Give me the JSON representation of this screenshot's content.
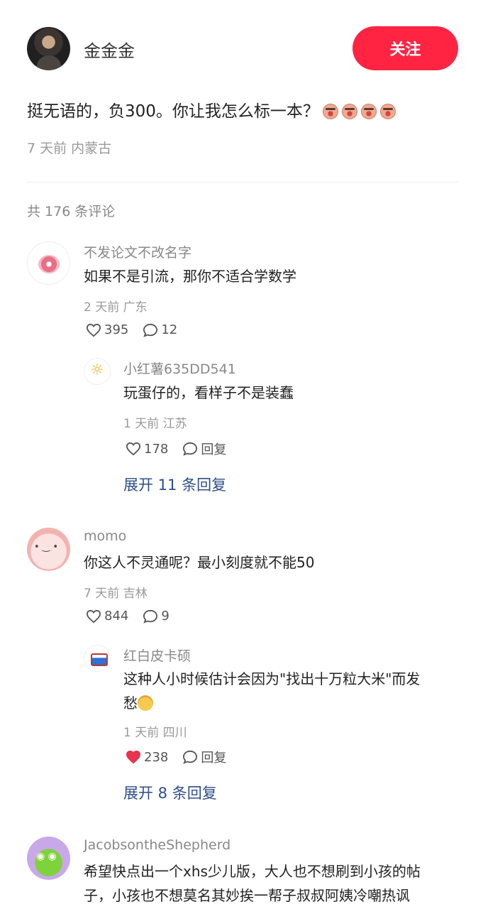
{
  "author": {
    "name": "金金金",
    "follow_label": "关注"
  },
  "post": {
    "text": "挺无语的，负300。你让我怎么标一本？",
    "emoji_count": 4,
    "meta": "7 天前 内蒙古"
  },
  "comments_header": "共 176 条评论",
  "comments": [
    {
      "name": "不发论文不改名字",
      "text": "如果不是引流，那你不适合学数学",
      "meta": "2 天前 广东",
      "likes": "395",
      "replies_count": "12",
      "reply": {
        "name": "小红薯635DD541",
        "text": "玩蛋仔的，看样子不是装蠢",
        "meta": "1 天前 江苏",
        "likes": "178",
        "reply_label": "回复"
      },
      "expand": "展开 11 条回复"
    },
    {
      "name": "momo",
      "text": "你这人不灵通呢？最小刻度就不能50",
      "meta": "7 天前 吉林",
      "likes": "844",
      "replies_count": "9",
      "reply": {
        "name": "红白皮卡硕",
        "text_line1": "这种人小时候估计会因为\"找出十万粒大米\"而发",
        "text_line2": "愁",
        "meta": "1 天前 四川",
        "likes": "238",
        "liked": true,
        "reply_label": "回复"
      },
      "expand": "展开 8 条回复"
    },
    {
      "name": "JacobsontheShepherd",
      "text_line1": "希望快点出一个xhs少儿版，大人也不想刷到小孩的帖",
      "text_line2": "子，小孩也不想莫名其妙挨一帮子叔叔阿姨冷嘲热讽"
    }
  ],
  "colors": {
    "accent": "#ff2442",
    "link": "#2c4e8a",
    "liked_heart": "#e8344f"
  },
  "icons": {
    "like": "heart-icon",
    "comment": "comment-bubble-icon"
  }
}
